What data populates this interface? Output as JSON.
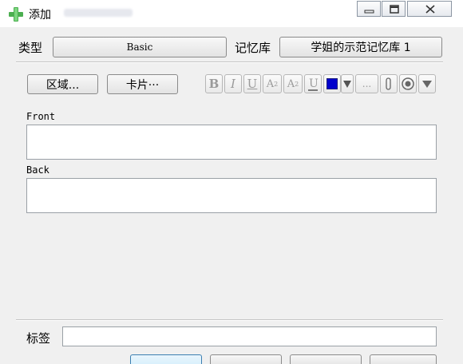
{
  "window": {
    "title": "添加"
  },
  "note_type": {
    "label": "类型",
    "value": "Basic"
  },
  "deck": {
    "label": "记忆库",
    "value": "学姐的示范记忆库 1"
  },
  "toolbar": {
    "fields_button": "区域...",
    "cards_button": "卡片···",
    "bold": "B",
    "italic": "I",
    "underline": "U",
    "superscript": "A",
    "subscript": "A",
    "more": "...",
    "text_color": "#0000cc"
  },
  "fields": [
    {
      "label": "Front",
      "value": ""
    },
    {
      "label": "Back",
      "value": ""
    }
  ],
  "tags": {
    "label": "标签",
    "value": ""
  }
}
